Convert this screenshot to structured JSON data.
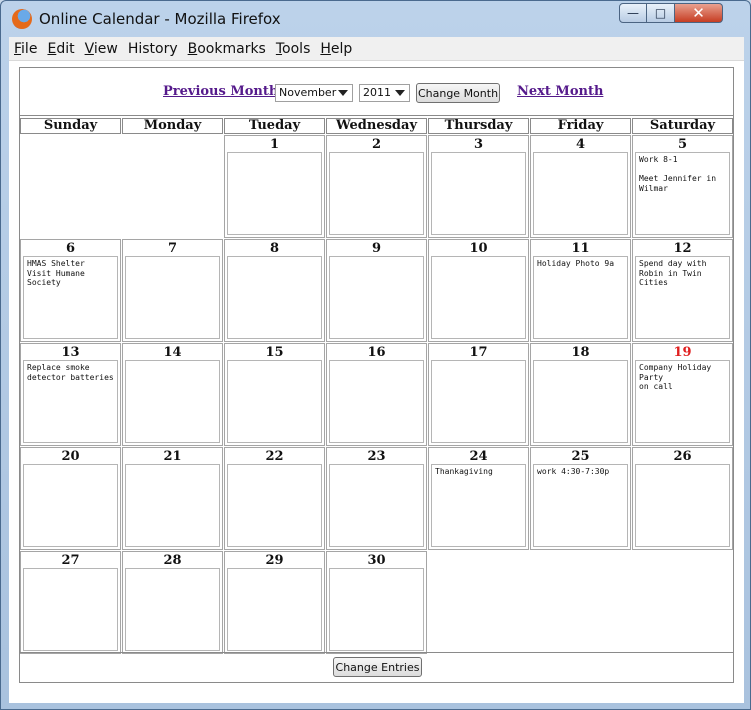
{
  "window": {
    "title": "Online Calendar - Mozilla Firefox",
    "minimize": "—",
    "maximize": "□",
    "close": "✕"
  },
  "menu": [
    {
      "u": "F",
      "rest": "ile"
    },
    {
      "u": "E",
      "rest": "dit"
    },
    {
      "u": "V",
      "rest": "iew"
    },
    {
      "u": "Hi",
      "rest": "story",
      "pre": ""
    },
    {
      "u": "B",
      "rest": "ookmarks"
    },
    {
      "u": "T",
      "rest": "ools"
    },
    {
      "u": "H",
      "rest": "elp"
    }
  ],
  "nav": {
    "previous_month": "Previous Month",
    "next_month": "Next Month",
    "month_selected": "November",
    "year_selected": "2011",
    "change_month": "Change Month"
  },
  "days": [
    "Sunday",
    "Monday",
    "Tueday",
    "Wednesday",
    "Thursday",
    "Friday",
    "Saturday"
  ],
  "calendar": {
    "first_weekday": 2,
    "days_in_month": 30,
    "highlight_day": 19,
    "highlight_color": "#e02020",
    "entries": {
      "5": [
        "Work 8-1",
        "",
        "Meet Jennifer in",
        "Wilmar"
      ],
      "6": [
        "HMAS Shelter",
        "Visit Humane",
        "Society"
      ],
      "11": [
        "Holiday Photo 9a"
      ],
      "12": [
        "Spend day with",
        "Robin in Twin",
        "Cities"
      ],
      "13": [
        "Replace smoke",
        "detector batteries"
      ],
      "19": [
        "Company Holiday",
        "Party",
        "on call"
      ],
      "24": [
        "Thankagiving"
      ],
      "25": [
        "work 4:30-7:30p"
      ]
    }
  },
  "footer": {
    "change_entries": "Change Entries"
  }
}
